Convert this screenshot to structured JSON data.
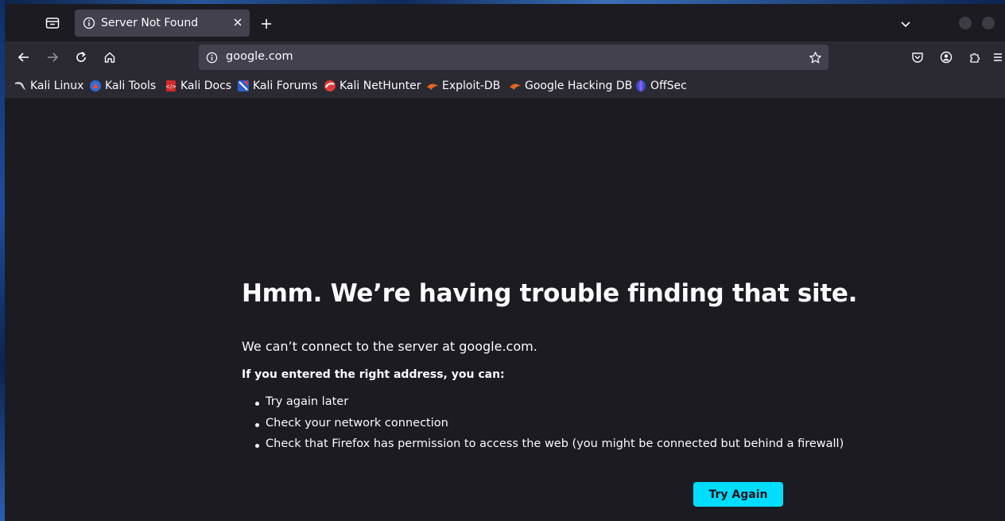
{
  "tab": {
    "title": "Server Not Found"
  },
  "navbar": {
    "url": "google.com"
  },
  "bookmarks": [
    {
      "label": "Kali Linux",
      "icon": "kali-dragon-icon"
    },
    {
      "label": "Kali Tools",
      "icon": "kali-tools-icon"
    },
    {
      "label": "Kali Docs",
      "icon": "kali-docs-icon"
    },
    {
      "label": "Kali Forums",
      "icon": "kali-forums-icon"
    },
    {
      "label": "Kali NetHunter",
      "icon": "nethunter-icon"
    },
    {
      "label": "Exploit-DB",
      "icon": "exploit-db-icon"
    },
    {
      "label": "Google Hacking DB",
      "icon": "ghdb-icon"
    },
    {
      "label": "OffSec",
      "icon": "offsec-icon"
    }
  ],
  "error": {
    "title": "Hmm. We’re having trouble finding that site.",
    "description": "We can’t connect to the server at google.com.",
    "subtitle": "If you entered the right address, you can:",
    "suggestions": [
      "Try again later",
      "Check your network connection",
      "Check that Firefox has permission to access the web (you might be connected but behind a firewall)"
    ],
    "button_label": "Try Again"
  },
  "colors": {
    "accent": "#00ddff",
    "page_background": "#1c1b22",
    "toolbar_background": "#2b2a33",
    "field_background": "#42414d"
  }
}
